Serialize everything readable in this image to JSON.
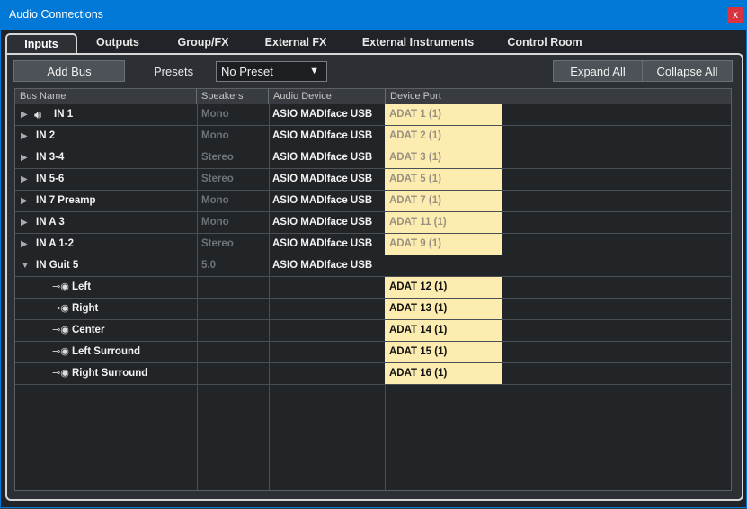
{
  "window": {
    "title": "Audio Connections",
    "close_label": "x"
  },
  "tabs": [
    "Inputs",
    "Outputs",
    "Group/FX",
    "External FX",
    "External Instruments",
    "Control Room"
  ],
  "toolbar": {
    "add_bus": "Add Bus",
    "presets_label": "Presets",
    "preset_value": "No Preset",
    "expand_all": "Expand All",
    "collapse_all": "Collapse All"
  },
  "columns": [
    "Bus Name",
    "Speakers",
    "Audio Device",
    "Device Port"
  ],
  "rows": [
    {
      "name": "IN 1",
      "speakers": "Mono",
      "device": "ASIO MADIface USB",
      "port": "ADAT 1 (1)"
    },
    {
      "name": "IN 2",
      "speakers": "Mono",
      "device": "ASIO MADIface USB",
      "port": "ADAT 2 (1)"
    },
    {
      "name": "IN 3-4",
      "speakers": "Stereo",
      "device": "ASIO MADIface USB",
      "port": "ADAT 3 (1)"
    },
    {
      "name": "IN 5-6",
      "speakers": "Stereo",
      "device": "ASIO MADIface USB",
      "port": "ADAT 5 (1)"
    },
    {
      "name": "IN 7 Preamp",
      "speakers": "Mono",
      "device": "ASIO MADIface USB",
      "port": "ADAT 7 (1)"
    },
    {
      "name": "IN A 3",
      "speakers": "Mono",
      "device": "ASIO MADIface USB",
      "port": "ADAT 11 (1)"
    },
    {
      "name": "IN A 1-2",
      "speakers": "Stereo",
      "device": "ASIO MADIface USB",
      "port": "ADAT 9 (1)"
    },
    {
      "name": "IN Guit 5",
      "speakers": "5.0",
      "device": "ASIO MADIface USB",
      "port": ""
    },
    {
      "name": "Left",
      "speakers": "",
      "device": "",
      "port": "ADAT 12 (1)"
    },
    {
      "name": "Right",
      "speakers": "",
      "device": "",
      "port": "ADAT 13 (1)"
    },
    {
      "name": "Center",
      "speakers": "",
      "device": "",
      "port": "ADAT 14 (1)"
    },
    {
      "name": "Left Surround",
      "speakers": "",
      "device": "",
      "port": "ADAT 15 (1)"
    },
    {
      "name": "Right Surround",
      "speakers": "",
      "device": "",
      "port": "ADAT 16 (1)"
    }
  ]
}
